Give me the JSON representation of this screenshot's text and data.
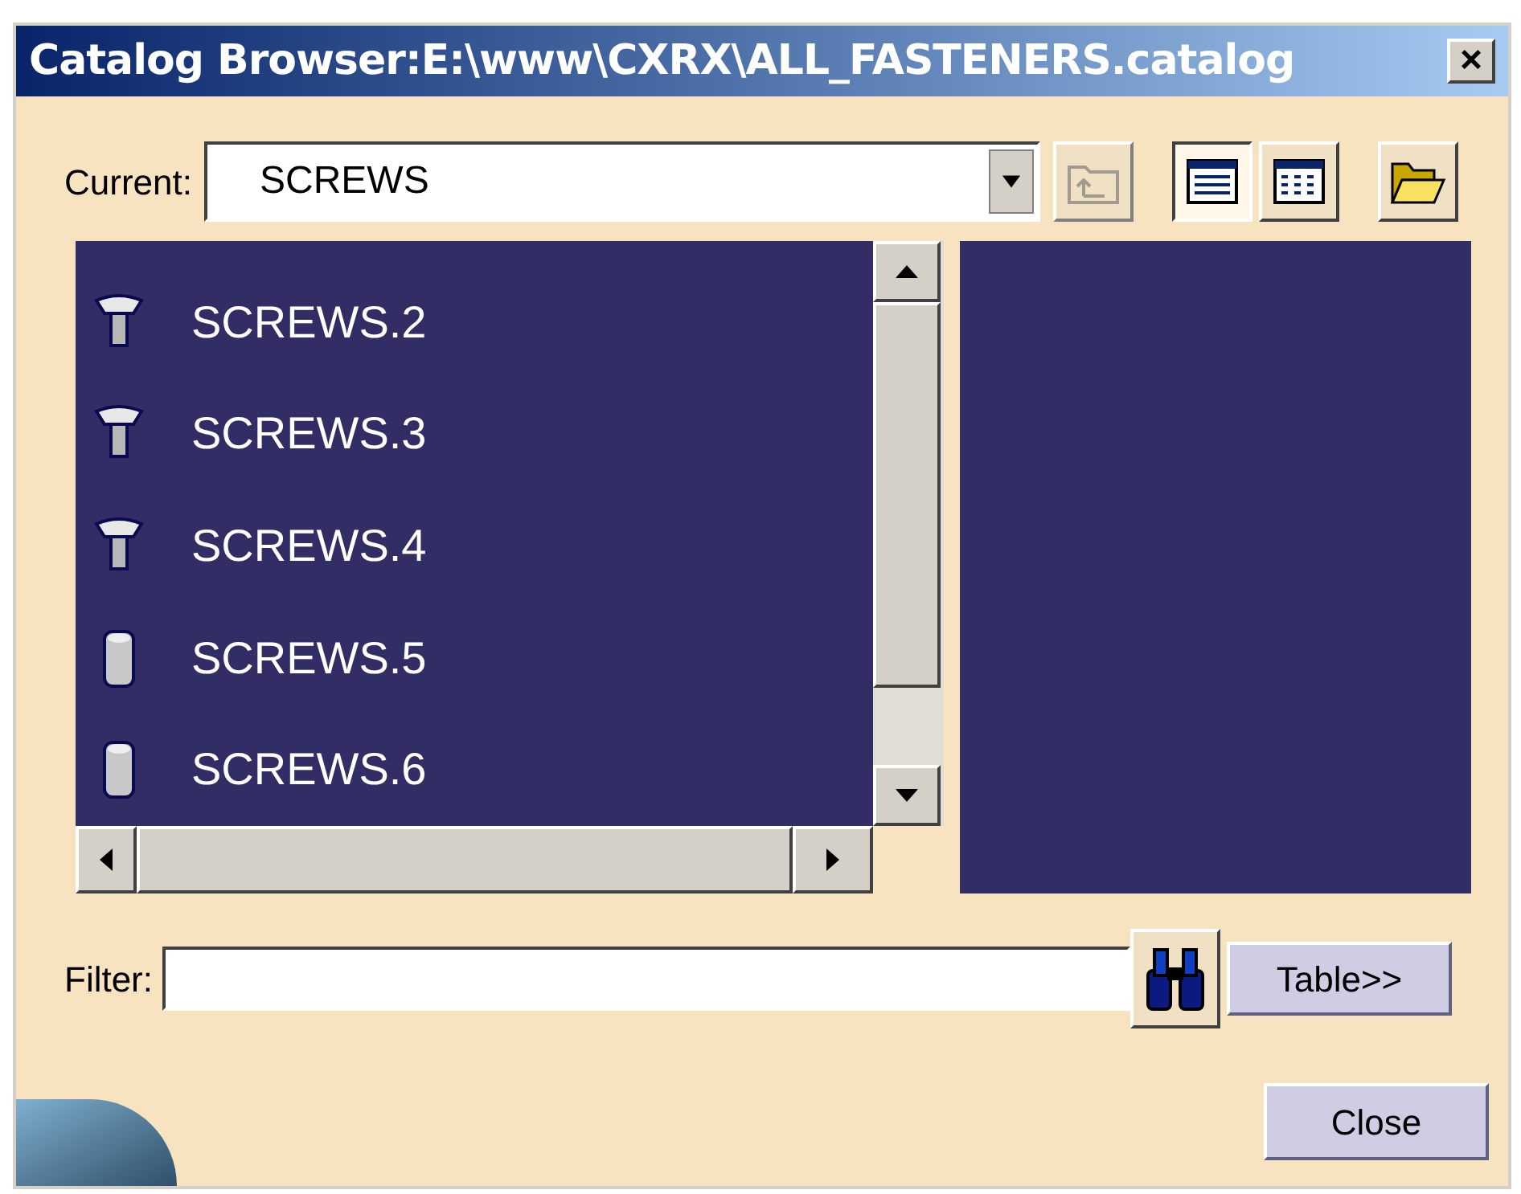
{
  "window": {
    "title": "Catalog Browser:E:\\www\\CXRX\\ALL_FASTENERS.catalog",
    "close": "×"
  },
  "current": {
    "label": "Current:",
    "value": "SCREWS",
    "up_disabled": true
  },
  "view_buttons": [
    {
      "kind": "list",
      "selected": true
    },
    {
      "kind": "grid",
      "selected": false
    }
  ],
  "items": [
    {
      "label": "SCREWS.2",
      "kind": "head"
    },
    {
      "label": "SCREWS.3",
      "kind": "head"
    },
    {
      "label": "SCREWS.4",
      "kind": "head"
    },
    {
      "label": "SCREWS.5",
      "kind": "cylinder"
    },
    {
      "label": "SCREWS.6",
      "kind": "cylinder"
    }
  ],
  "filter": {
    "label": "Filter:"
  },
  "buttons": {
    "table": "Table>>",
    "close": "Close"
  }
}
